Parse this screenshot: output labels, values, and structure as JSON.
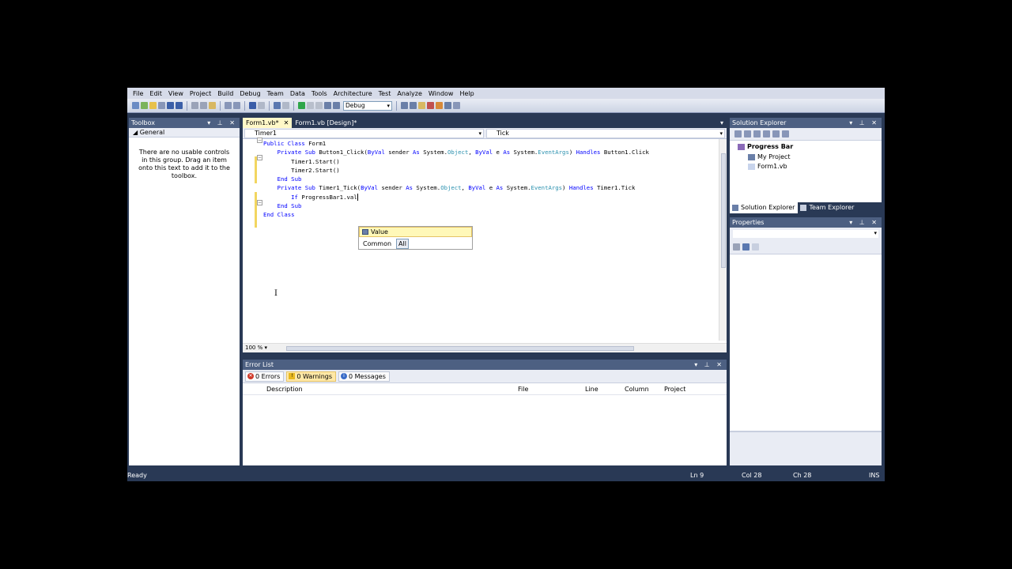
{
  "menu": [
    "File",
    "Edit",
    "View",
    "Project",
    "Build",
    "Debug",
    "Team",
    "Data",
    "Tools",
    "Architecture",
    "Test",
    "Analyze",
    "Window",
    "Help"
  ],
  "toolbar": {
    "config": "Debug"
  },
  "toolbox": {
    "title": "Toolbox",
    "group": "General",
    "empty_text": "There are no usable controls in this group. Drag an item onto this text to add it to the toolbox."
  },
  "editor": {
    "tabs": [
      {
        "label": "Form1.vb*",
        "active": true
      },
      {
        "label": "Form1.vb [Design]*",
        "active": false
      }
    ],
    "nav_left": "Timer1",
    "nav_right": "Tick",
    "code_lines": [
      {
        "indent": 0,
        "text": "Public Class Form1"
      },
      {
        "indent": 0,
        "text": ""
      },
      {
        "indent": 1,
        "text": "Private Sub Button1_Click(ByVal sender As System.Object, ByVal e As System.EventArgs) Handles Button1.Click"
      },
      {
        "indent": 2,
        "text": "Timer1.Start()"
      },
      {
        "indent": 2,
        "text": "Timer2.Start()"
      },
      {
        "indent": 1,
        "text": "End Sub"
      },
      {
        "indent": 0,
        "text": ""
      },
      {
        "indent": 1,
        "text": "Private Sub Timer1_Tick(ByVal sender As System.Object, ByVal e As System.EventArgs) Handles Timer1.Tick"
      },
      {
        "indent": 2,
        "text": "If ProgressBar1.val"
      },
      {
        "indent": 1,
        "text": "End Sub"
      },
      {
        "indent": 0,
        "text": "End Class"
      }
    ],
    "zoom": "100 %"
  },
  "intellisense": {
    "item": "Value",
    "filters": [
      "Common",
      "All"
    ],
    "selected_filter": "All"
  },
  "error_list": {
    "title": "Error List",
    "errors": "0 Errors",
    "warnings": "0 Warnings",
    "messages": "0 Messages",
    "columns": [
      "Description",
      "File",
      "Line",
      "Column",
      "Project"
    ]
  },
  "solution_explorer": {
    "title": "Solution Explorer",
    "tree": [
      {
        "label": "Progress Bar",
        "level": 0,
        "bold": true
      },
      {
        "label": "My Project",
        "level": 1,
        "bold": false
      },
      {
        "label": "Form1.vb",
        "level": 1,
        "bold": false
      }
    ],
    "tabs": [
      "Solution Explorer",
      "Team Explorer"
    ]
  },
  "properties": {
    "title": "Properties"
  },
  "status": {
    "ready": "Ready",
    "line": "Ln 9",
    "col": "Col 28",
    "ch": "Ch 28",
    "mode": "INS"
  },
  "colors": {
    "chrome": "#293955",
    "panel_title": "#4d6082",
    "keyword": "#0000ff",
    "type": "#2b91af",
    "active_tab": "#fff8c8"
  }
}
